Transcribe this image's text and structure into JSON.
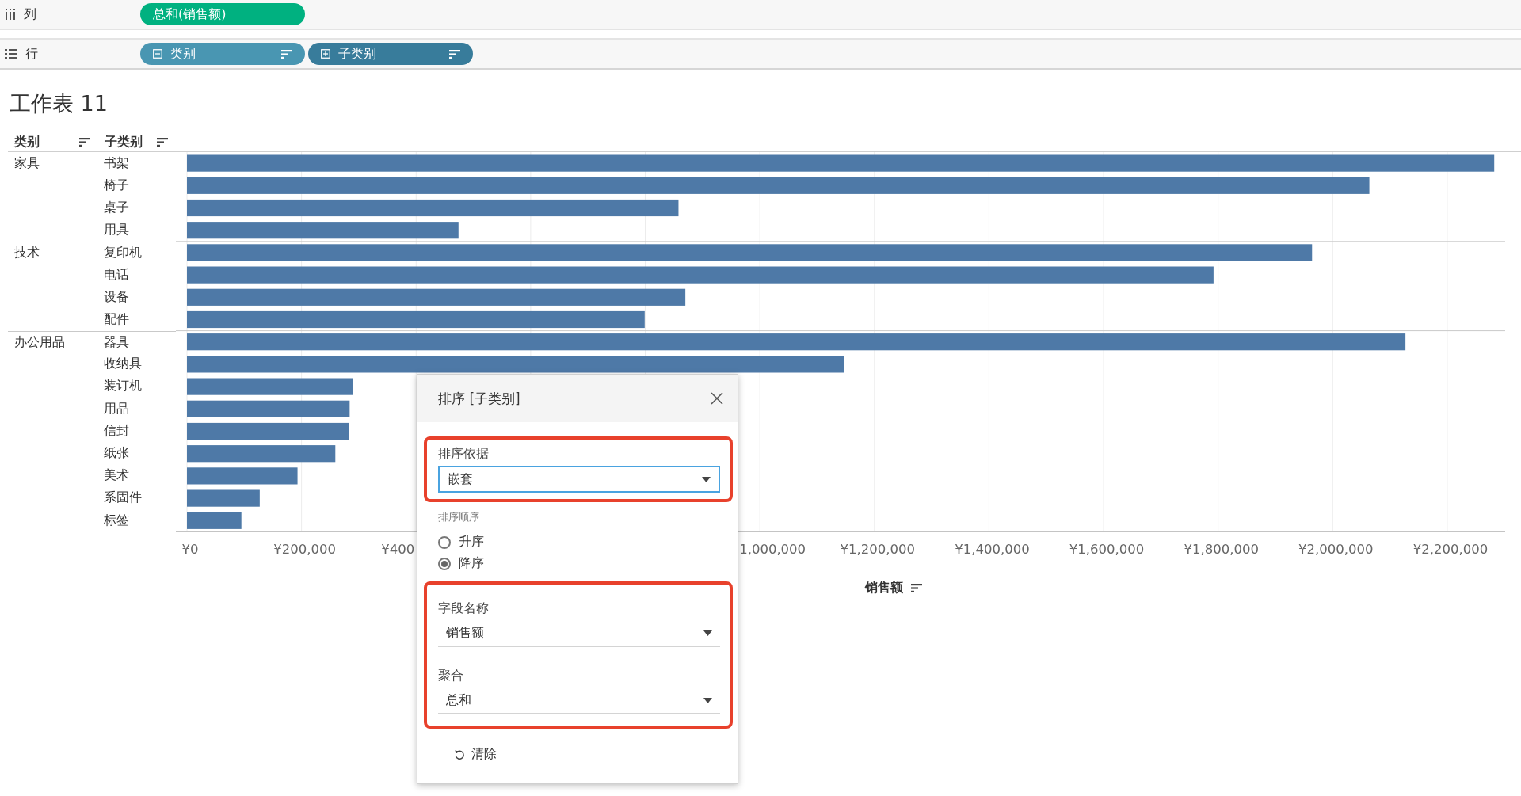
{
  "shelves": [
    {
      "kind": "columns",
      "label": "列",
      "pills": [
        {
          "text": "总和(销售额)",
          "kind": "measure",
          "color": "#00b180"
        }
      ]
    },
    {
      "kind": "rows",
      "label": "行",
      "pills": [
        {
          "text": "类别",
          "kind": "dimension",
          "color": "#4996b2",
          "expanded": true
        },
        {
          "text": "子类别",
          "kind": "dimension",
          "color": "#387c9b",
          "expanded": false
        }
      ]
    }
  ],
  "sheet_title": "工作表 11",
  "row_headers": [
    "类别",
    "子类别"
  ],
  "category_groups": [
    {
      "label": "家具",
      "subcategories": [
        "书架",
        "椅子",
        "桌子",
        "用具"
      ]
    },
    {
      "label": "技术",
      "subcategories": [
        "复印机",
        "电话",
        "设备",
        "配件"
      ]
    },
    {
      "label": "办公用品",
      "subcategories": [
        "器具",
        "收纳具",
        "装订机",
        "用品",
        "信封",
        "纸张",
        "美术",
        "系固件",
        "标签"
      ]
    }
  ],
  "chart_data": {
    "type": "bar",
    "orientation": "horizontal",
    "xlabel": "销售额",
    "values": [
      2282000,
      2064000,
      858000,
      474000,
      1964000,
      1792000,
      870000,
      799000,
      2127000,
      1147000,
      289000,
      284000,
      283000,
      259000,
      193000,
      127000,
      95000
    ],
    "xlim": [
      0,
      2290000
    ],
    "grid": true,
    "xticks": [
      {
        "value": 0,
        "label": "¥0"
      },
      {
        "value": 200000,
        "label": "¥200,000"
      },
      {
        "value": 1200000,
        "label": "¥1,200,000"
      },
      {
        "value": 1400000,
        "label": "¥1,400,000"
      },
      {
        "value": 1600000,
        "label": "¥1,600,000"
      },
      {
        "value": 1800000,
        "label": "¥1,800,000"
      },
      {
        "value": 2000000,
        "label": "¥2,000,000"
      },
      {
        "value": 2200000,
        "label": "¥2,200,000"
      }
    ]
  },
  "axis_label_fragments": [
    "¥400",
    "1,000,000"
  ],
  "dialog": {
    "title": "排序 [子类别]",
    "sections": [
      {
        "kind": "fields",
        "highlighted": true,
        "fields": [
          {
            "label": "排序依据",
            "value": "嵌套"
          }
        ]
      },
      {
        "kind": "radio",
        "highlighted": false,
        "label": "排序顺序",
        "options": [
          {
            "label": "升序",
            "selected": false
          },
          {
            "label": "降序",
            "selected": true
          }
        ]
      },
      {
        "kind": "fields",
        "highlighted": true,
        "fields": [
          {
            "label": "字段名称",
            "value": "销售额"
          },
          {
            "label": "聚合",
            "value": "总和"
          }
        ]
      }
    ],
    "clear_button": "清除"
  }
}
